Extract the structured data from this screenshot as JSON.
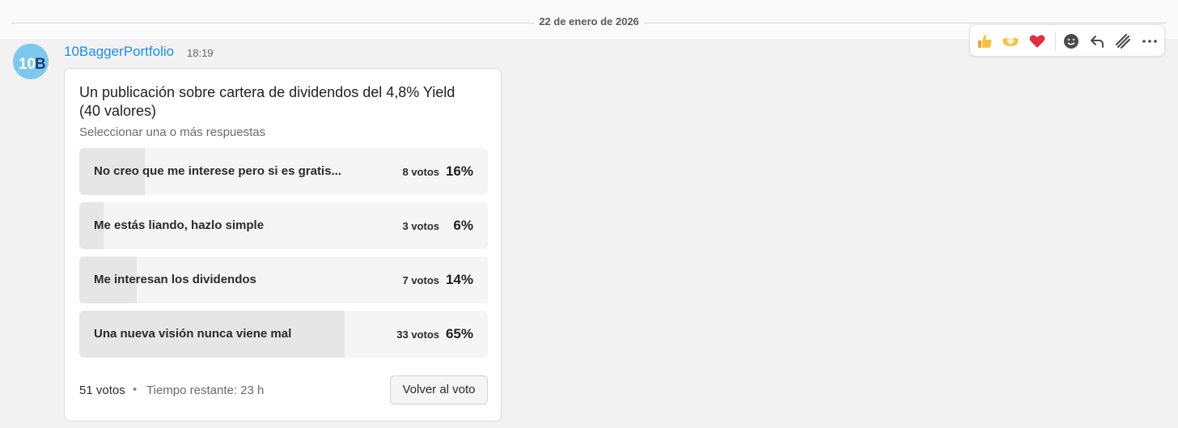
{
  "date_divider": "22 de enero de 2026",
  "message": {
    "author": "10BaggerPortfolio",
    "time": "18:19",
    "avatar_text": "10B"
  },
  "poll": {
    "question": "Un publicación sobre cartera de dividendos del 4,8% Yield (40 valores)",
    "instruction": "Seleccionar una o más respuestas",
    "options": [
      {
        "label": "No creo que me interese pero si es gratis...",
        "votes": "8 votos",
        "percent": "16%",
        "fill": 0.16
      },
      {
        "label": "Me estás liando, hazlo simple",
        "votes": "3 votos",
        "percent": "6%",
        "fill": 0.06
      },
      {
        "label": "Me interesan los dividendos",
        "votes": "7 votos",
        "percent": "14%",
        "fill": 0.14
      },
      {
        "label": "Una nueva visión nunca viene mal",
        "votes": "33 votos",
        "percent": "65%",
        "fill": 0.65
      }
    ],
    "total_votes": "51 votos",
    "separator": "•",
    "time_remaining": "Tiempo restante: 23 h",
    "revote_label": "Volver al voto"
  },
  "toolbar": {
    "items": [
      "thumbs-up-icon",
      "heart-hands-icon",
      "heart-icon",
      "add-reaction-icon",
      "reply-icon",
      "forward-icon",
      "more-icon"
    ]
  },
  "colors": {
    "link": "#1d8fe0",
    "avatar_bg": "#7ec8ee",
    "avatar_text": "#1b3f73",
    "bar_fill": "#e6e6e6",
    "bar_bg": "#f5f5f5"
  }
}
